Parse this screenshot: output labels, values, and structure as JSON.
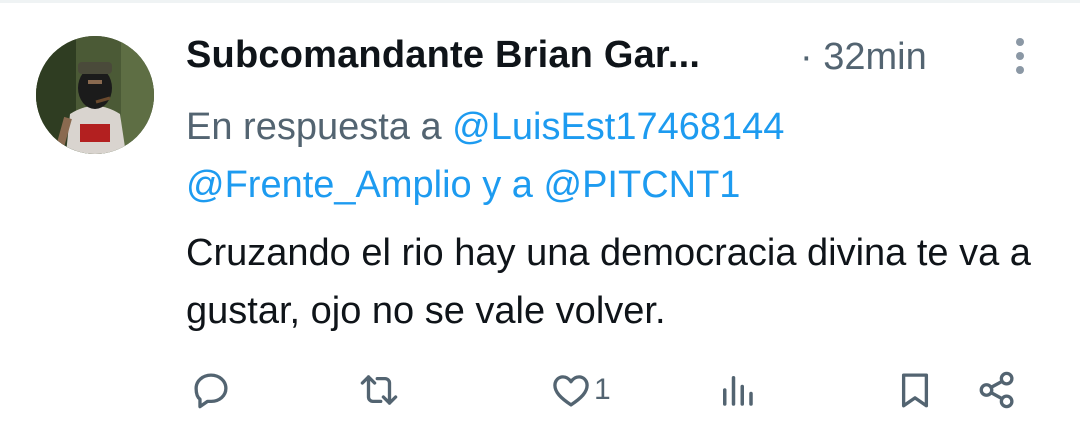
{
  "tweet": {
    "author_name": "Subcomandante Brian Gar...",
    "separator": "·",
    "time": "32min",
    "reply_prefix": "En respuesta a",
    "mention_1": "@LuisEst17468144",
    "mention_2": "@Frente_Amplio",
    "reply_conjunction": "y a",
    "mention_3": "@PITCNT1",
    "text": "Cruzando el rio hay una democracia divina te va a gustar, ojo no se vale volver.",
    "likes_count": "1"
  },
  "icons": {
    "reply": "reply-icon",
    "retweet": "retweet-icon",
    "like": "heart-icon",
    "views": "views-icon",
    "bookmark": "bookmark-icon",
    "share": "share-icon",
    "more": "more-vertical-icon"
  },
  "colors": {
    "link": "#1d9bf0",
    "muted": "#536471",
    "text": "#0f1419"
  }
}
